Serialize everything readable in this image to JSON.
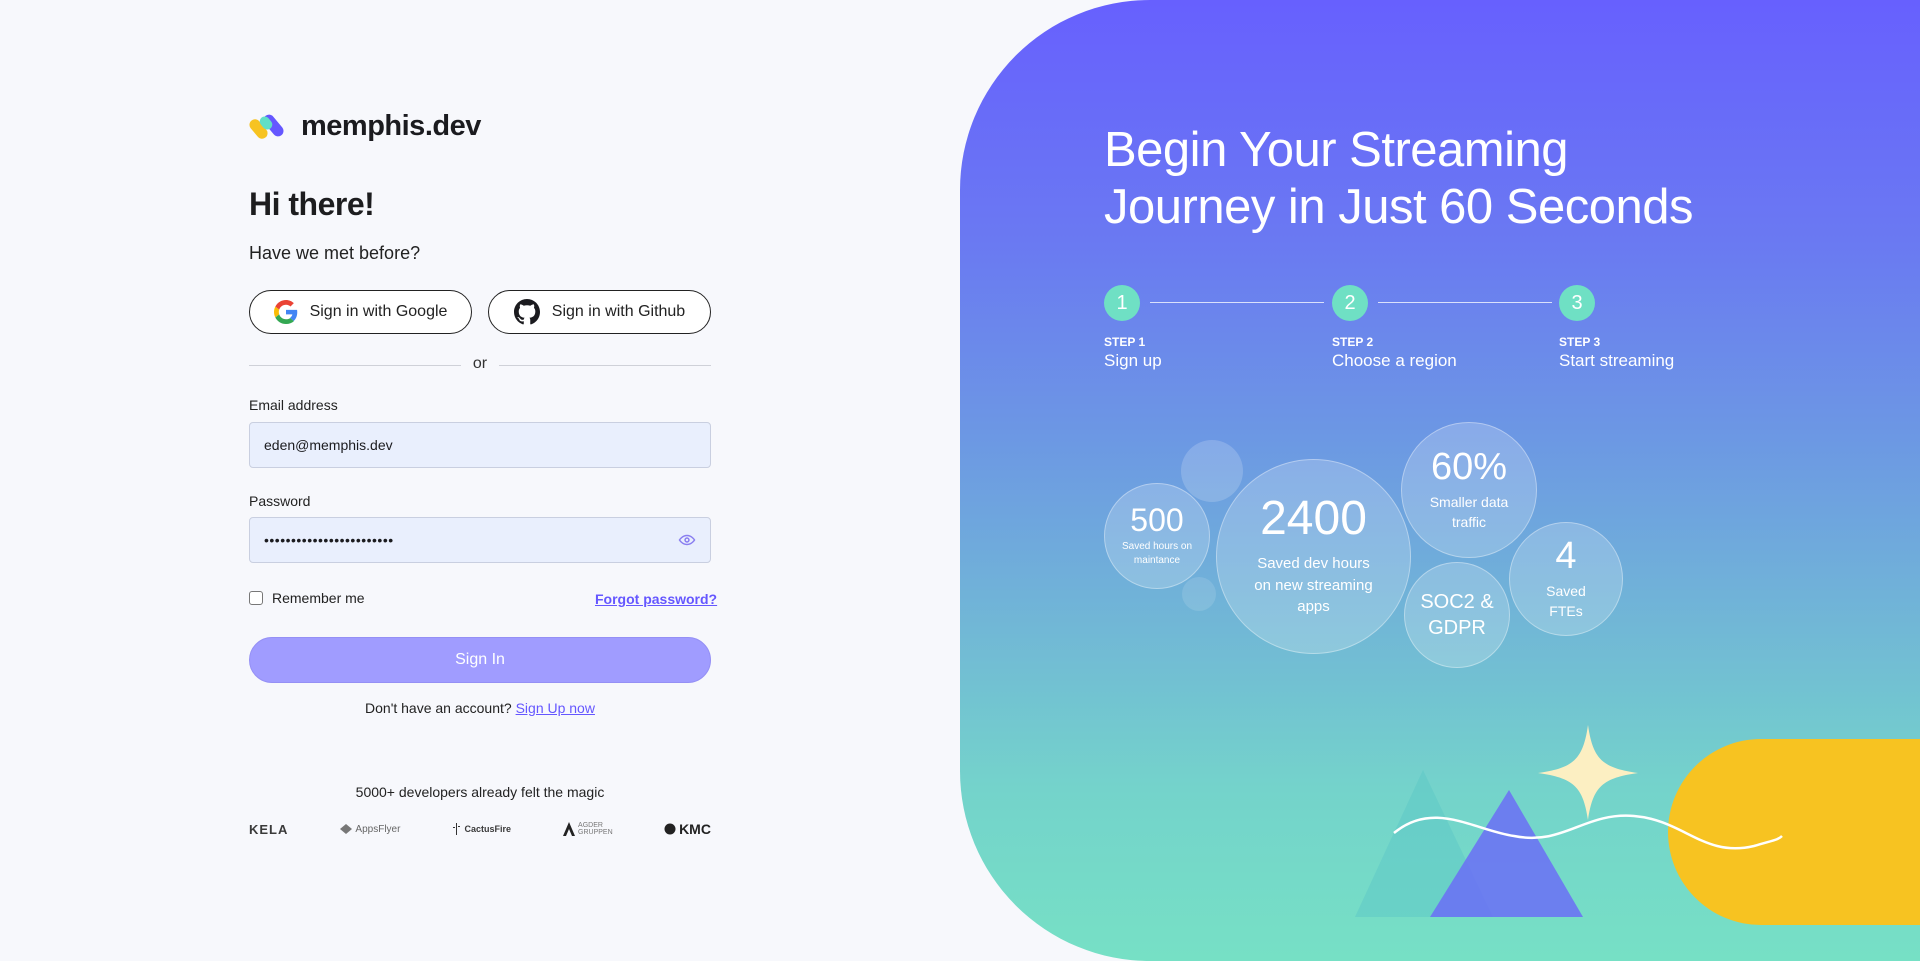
{
  "brand": {
    "name": "memphis.dev"
  },
  "login": {
    "greeting": "Hi there!",
    "subtitle": "Have we met before?",
    "google_label": "Sign in with Google",
    "github_label": "Sign in with Github",
    "divider_text": "or",
    "email_label": "Email address",
    "email_value": "eden@memphis.dev",
    "password_label": "Password",
    "password_value": "••••••••••••••••••••••••",
    "remember_label": "Remember me",
    "remember_checked": false,
    "forgot_label": "Forgot password?",
    "signin_label": "Sign In",
    "no_account_text": "Don't have an account? ",
    "signup_label": "Sign Up now",
    "social_proof": "5000+ developers already felt the magic",
    "customers": [
      "KELA",
      "AppsFlyer",
      "CactusFire",
      "AGDER GRUPPEN",
      "KMC"
    ]
  },
  "hero": {
    "title_line1": "Begin Your Streaming",
    "title_line2": "Journey in Just 60 Seconds",
    "steps": [
      {
        "number": "1",
        "small": "STEP 1",
        "title": "Sign up"
      },
      {
        "number": "2",
        "small": "STEP 2",
        "title": "Choose a region"
      },
      {
        "number": "3",
        "small": "STEP 3",
        "title": "Start streaming"
      }
    ],
    "stats": [
      {
        "value": "500",
        "label": "Saved hours on maintance"
      },
      {
        "value": "2400",
        "label": "Saved dev hours on new streaming apps"
      },
      {
        "value": "60%",
        "label": "Smaller data traffic"
      },
      {
        "value": "SOC2 & GDPR",
        "label": ""
      },
      {
        "value": "4",
        "label": "Saved FTEs"
      }
    ]
  },
  "colors": {
    "accent": "#6557ff",
    "signin_button": "#a09cff",
    "step_circle": "#6fe0c4",
    "yellow": "#f7c321",
    "gradient_top": "#6760fe",
    "gradient_bottom": "#76e0c5"
  },
  "icons": [
    "memphis-logo-icon",
    "google-icon",
    "github-icon",
    "eye-icon",
    "sparkle-icon",
    "triangle-icon",
    "wave-icon"
  ]
}
